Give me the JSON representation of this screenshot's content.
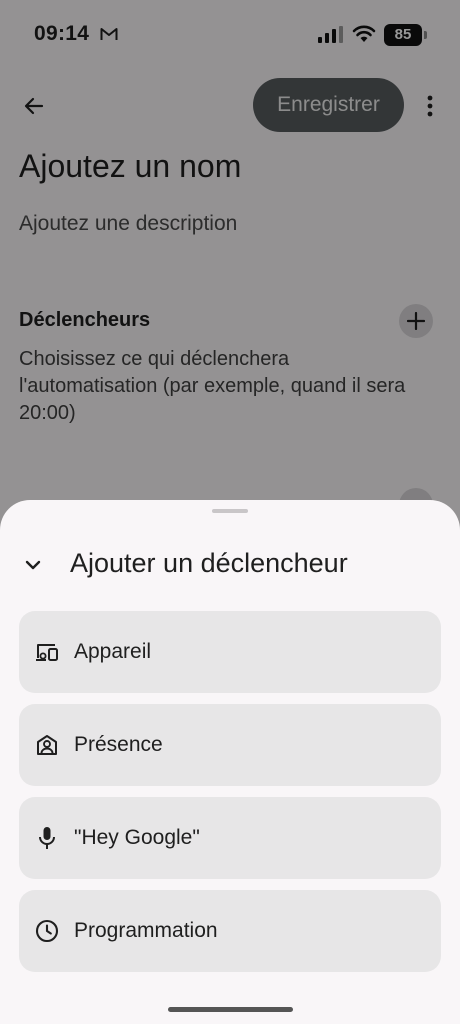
{
  "status_bar": {
    "time": "09:14",
    "battery": "85"
  },
  "header": {
    "save_label": "Enregistrer"
  },
  "automation": {
    "name_placeholder": "Ajoutez un nom",
    "description_placeholder": "Ajoutez une description"
  },
  "triggers_section": {
    "title": "Déclencheurs",
    "description": "Choisissez ce qui déclenchera l'automatisation (par exemple, quand il sera 20:00)"
  },
  "sheet": {
    "title": "Ajouter un déclencheur",
    "options": [
      {
        "label": "Appareil",
        "icon": "device-icon"
      },
      {
        "label": "Présence",
        "icon": "presence-icon"
      },
      {
        "label": "\"Hey Google\"",
        "icon": "microphone-icon"
      },
      {
        "label": "Programmation",
        "icon": "clock-icon"
      }
    ]
  },
  "colors": {
    "scrim": "#000000",
    "save_button": "#555a5d",
    "sheet_bg": "#f9f6f8",
    "option_bg": "#e7e6e7"
  }
}
